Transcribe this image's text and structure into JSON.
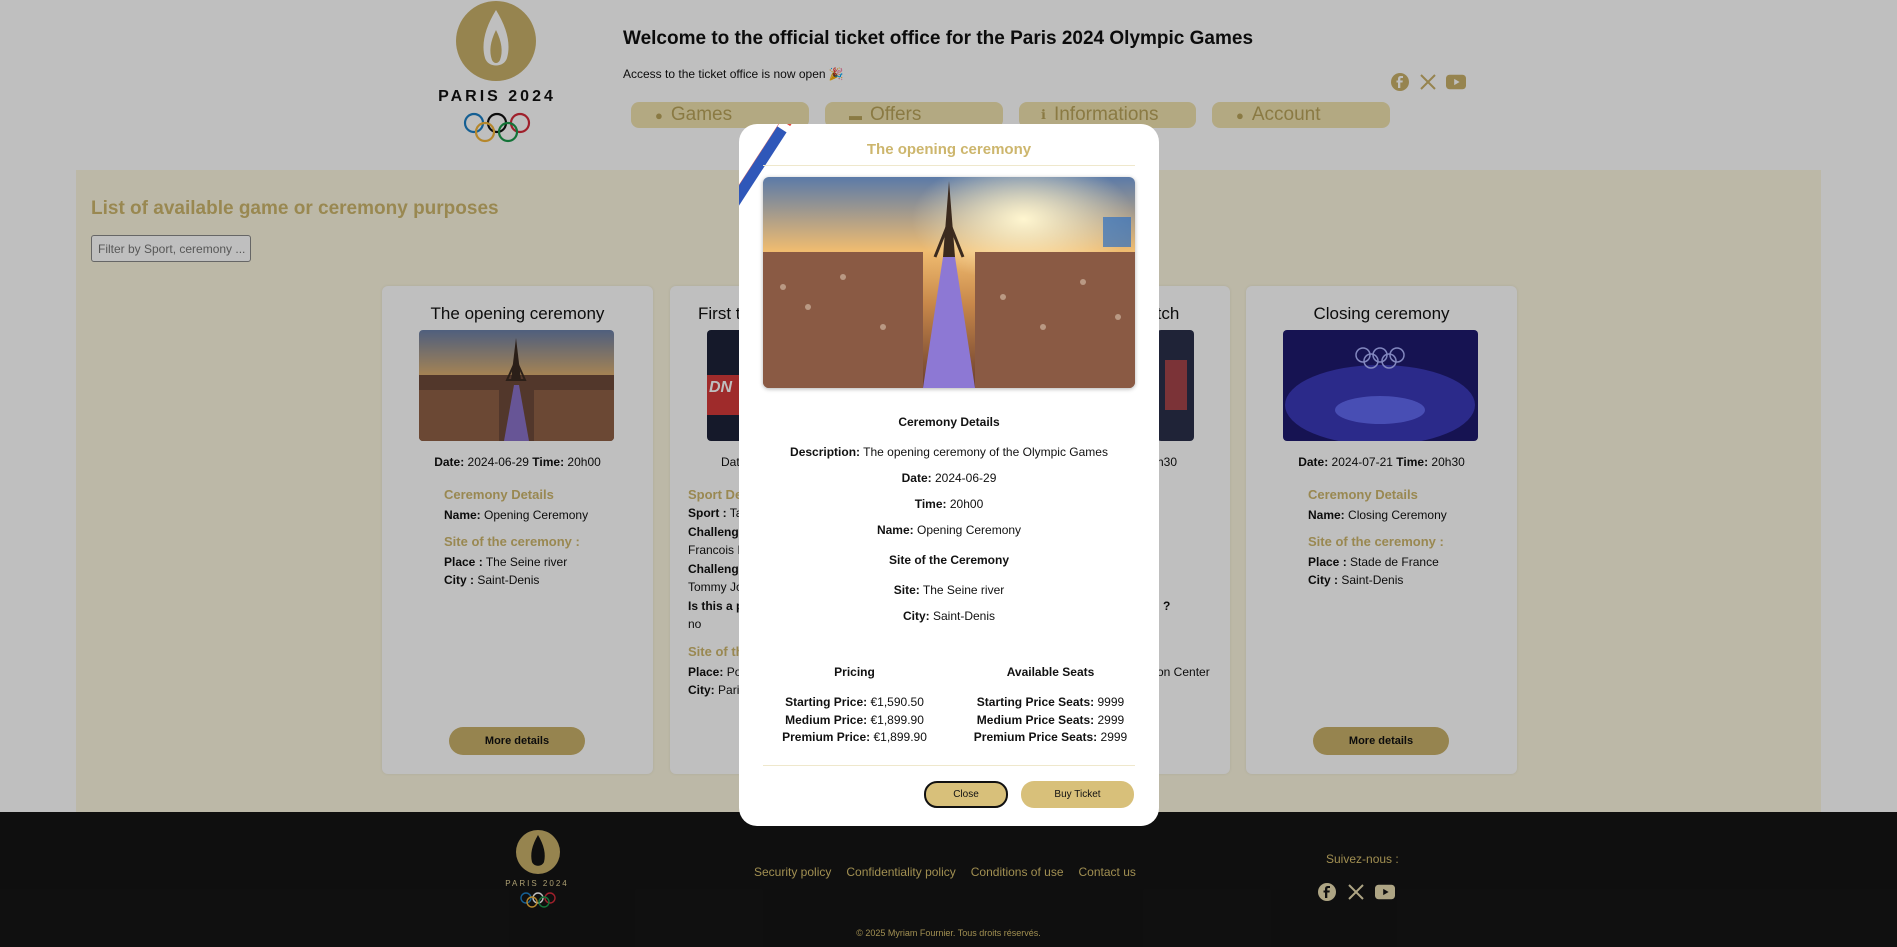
{
  "header": {
    "brand": "PARIS 2024",
    "welcome": "Welcome to the official ticket office for the Paris 2024 Olympic Games",
    "access": "Access to the ticket office is now open 🎉",
    "nav": [
      {
        "label": "Games",
        "icon": "basketball-icon"
      },
      {
        "label": "Offers",
        "icon": "ticket-icon"
      },
      {
        "label": "Informations",
        "icon": "info-icon"
      },
      {
        "label": "Account",
        "icon": "user-icon"
      }
    ],
    "social": [
      "facebook-icon",
      "x-icon",
      "youtube-icon"
    ]
  },
  "main": {
    "title": "List of available game or ceremony purposes",
    "filter_placeholder": "Filter by Sport, ceremony ...",
    "cards": [
      {
        "title": "The opening ceremony",
        "date_label": "Date:",
        "date": "2024-06-29",
        "time_label": "Time:",
        "time": "20h00",
        "details_heading": "Ceremony Details",
        "name_label": "Name:",
        "name": "Opening Ceremony",
        "site_heading": "Site of the ceremony :",
        "place_label": "Place :",
        "place": "The Seine river",
        "city_label": "City :",
        "city": "Saint-Denis",
        "button": "More details"
      },
      {
        "title": "First t",
        "date_label": "Dat",
        "details_heading": "Sport De",
        "sport_label": "Sport :",
        "sport": "Ta",
        "challenger1_label": "Challeng",
        "challenger1": "Francois I",
        "challenger2_label": "Challeng",
        "challenger2": "Tommy Jo",
        "final_label": "Is this a p",
        "final": "no",
        "site_heading": "Site of th",
        "place_label": "Place:",
        "place": "Po",
        "city_label": "City:",
        "city": "Pari"
      },
      {
        "title": "match",
        "time_fragment": "h30",
        "final_fragment": "?",
        "place_fragment": "on Center"
      },
      {
        "title": "Closing ceremony",
        "date_label": "Date:",
        "date": "2024-07-21",
        "time_label": "Time:",
        "time": "20h30",
        "details_heading": "Ceremony Details",
        "name_label": "Name:",
        "name": "Closing Ceremony",
        "site_heading": "Site of the ceremony :",
        "place_label": "Place :",
        "place": "Stade de France",
        "city_label": "City :",
        "city": "Saint-Denis",
        "button": "More details"
      }
    ]
  },
  "modal": {
    "title": "The opening ceremony",
    "details_heading": "Ceremony Details",
    "description_label": "Description:",
    "description": "The opening ceremony of the Olympic Games",
    "date_label": "Date:",
    "date": "2024-06-29",
    "time_label": "Time:",
    "time": "20h00",
    "name_label": "Name:",
    "name": "Opening Ceremony",
    "site_heading": "Site of the Ceremony",
    "site_label": "Site:",
    "site": "The Seine river",
    "city_label": "City:",
    "city": "Saint-Denis",
    "pricing_heading": "Pricing",
    "seats_heading": "Available Seats",
    "prices": [
      {
        "label": "Starting Price:",
        "value": "€1,590.50"
      },
      {
        "label": "Medium Price:",
        "value": "€1,899.90"
      },
      {
        "label": "Premium Price:",
        "value": "€1,899.90"
      }
    ],
    "seats": [
      {
        "label": "Starting Price Seats:",
        "value": "9999"
      },
      {
        "label": "Medium Price Seats:",
        "value": "2999"
      },
      {
        "label": "Premium Price Seats:",
        "value": "2999"
      }
    ],
    "close_button": "Close",
    "buy_button": "Buy Ticket"
  },
  "footer": {
    "brand": "PARIS 2024",
    "links": [
      "Security policy",
      "Confidentiality policy",
      "Conditions of use",
      "Contact us"
    ],
    "follow": "Suivez-nous :",
    "copyright": "© 2025 Myriam Fournier. Tous droits réservés."
  },
  "colors": {
    "gold": "#cdb66d",
    "nav_bg": "#efe2ae",
    "main_bg": "#fbf6df",
    "button": "#c9b06a",
    "footer_bg": "#151515"
  }
}
